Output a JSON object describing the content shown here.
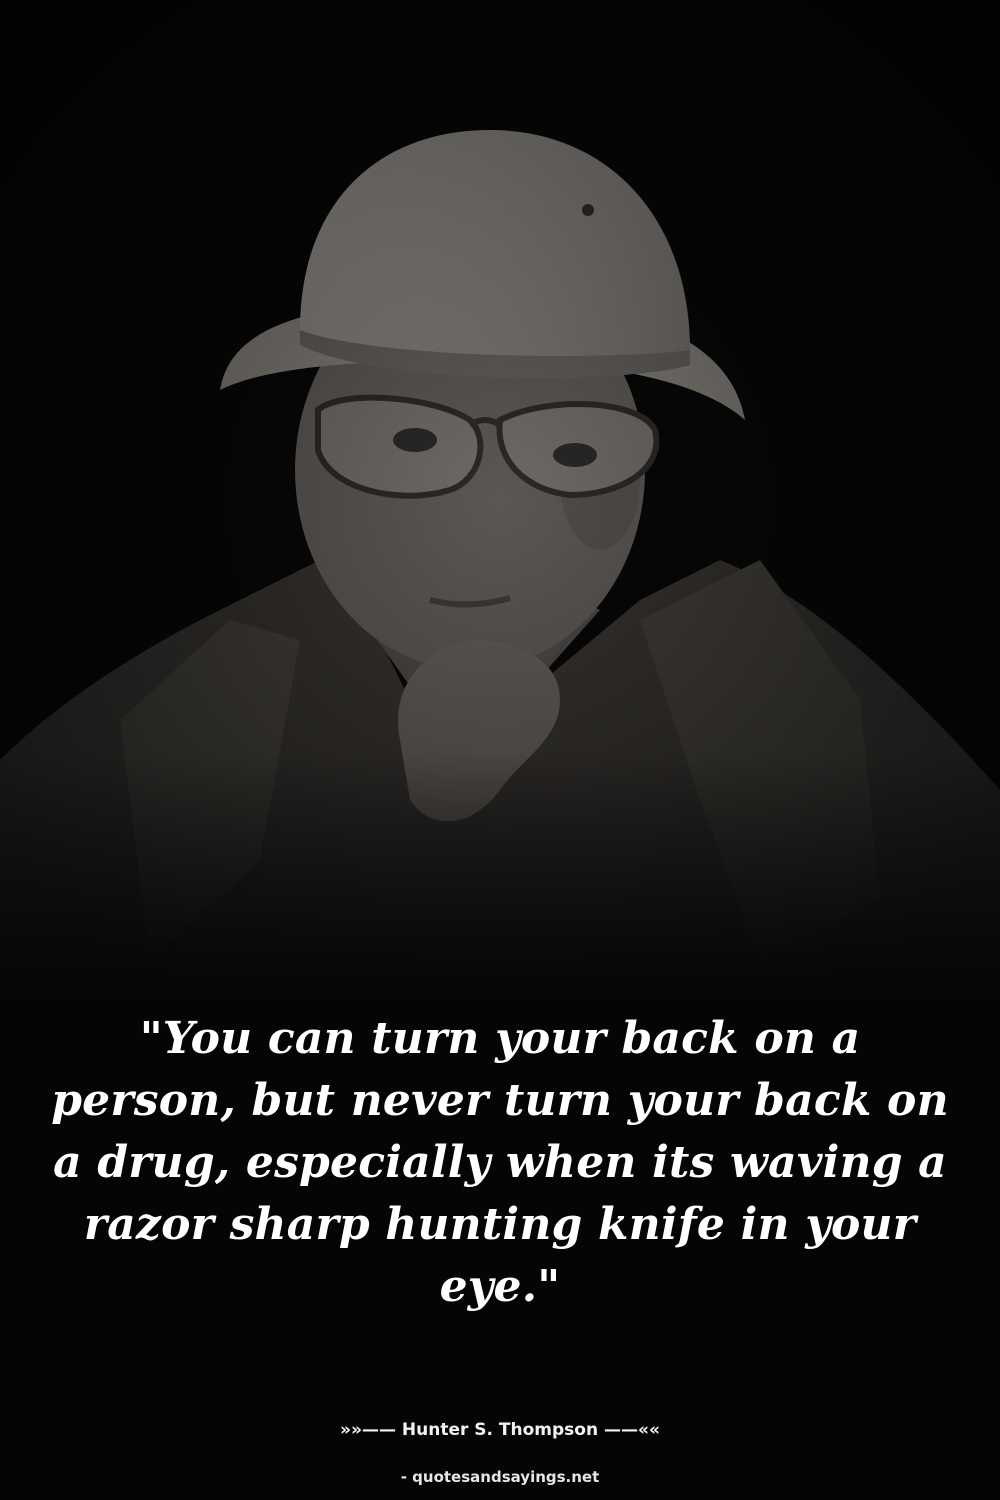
{
  "quote": {
    "text": "\"You can turn your back on a person, but never turn your back on a drug, especially when its waving a razor sharp hunting knife in your eye.\""
  },
  "attribution": {
    "text": "»»—— Hunter S. Thompson ——««"
  },
  "source": {
    "text": "- quotesandsayings.net"
  },
  "photo": {
    "subject": "man in pith helmet and glasses, hand on chin",
    "palette": {
      "background": "#050505",
      "hat": "#8e8a85",
      "skin": "#5d5955",
      "jacket": "#3b3835"
    }
  }
}
